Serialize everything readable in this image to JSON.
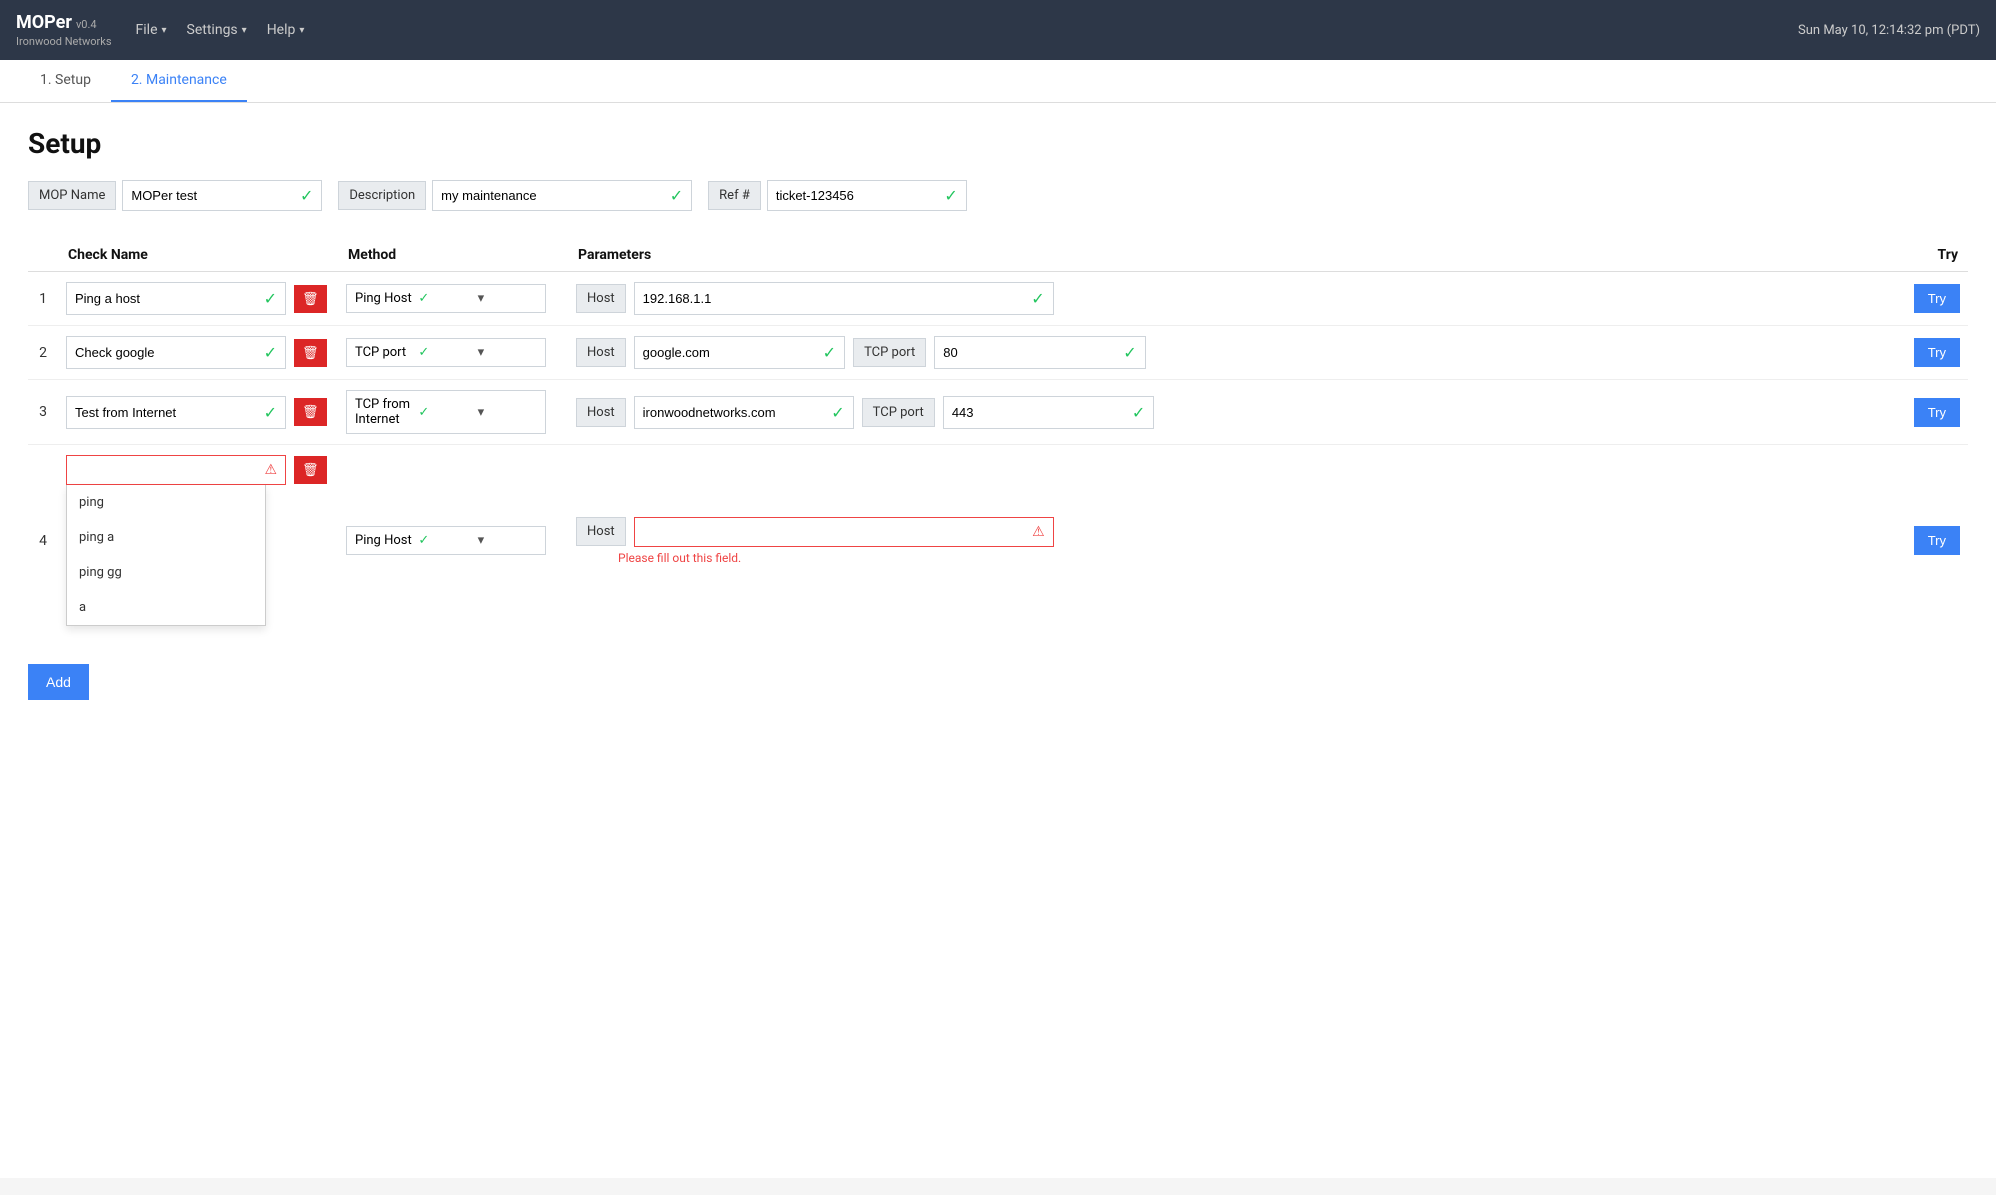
{
  "header": {
    "app_name": "MOPer",
    "app_version": "v0.4",
    "app_company": "Ironwood Networks",
    "nav": [
      {
        "label": "File",
        "id": "file"
      },
      {
        "label": "Settings",
        "id": "settings"
      },
      {
        "label": "Help",
        "id": "help"
      }
    ],
    "datetime": "Sun May 10, 12:14:32 pm (PDT)"
  },
  "tabs": [
    {
      "label": "1. Setup",
      "id": "setup",
      "active": false
    },
    {
      "label": "2. Maintenance",
      "id": "maintenance",
      "active": true
    }
  ],
  "page_title": "Setup",
  "setup_fields": {
    "mop_name_label": "MOP Name",
    "mop_name_value": "MOPer test",
    "description_label": "Description",
    "description_value": "my maintenance",
    "ref_label": "Ref #",
    "ref_value": "ticket-123456"
  },
  "table": {
    "columns": {
      "check_name": "Check Name",
      "method": "Method",
      "parameters": "Parameters",
      "try": "Try"
    },
    "rows": [
      {
        "num": "1",
        "check_name": "Ping a host",
        "valid": true,
        "method": "Ping Host",
        "params": [
          {
            "label": "Host",
            "value": "192.168.1.1",
            "valid": true
          }
        ]
      },
      {
        "num": "2",
        "check_name": "Check google",
        "valid": true,
        "method": "TCP port",
        "params": [
          {
            "label": "Host",
            "value": "google.com",
            "valid": true
          },
          {
            "label": "TCP port",
            "value": "80",
            "valid": true
          }
        ]
      },
      {
        "num": "3",
        "check_name": "Test from Internet",
        "valid": true,
        "method": "TCP from Internet",
        "params": [
          {
            "label": "Host",
            "value": "ironwoodnetworks.com",
            "valid": true
          },
          {
            "label": "TCP port",
            "value": "443",
            "valid": true
          }
        ]
      },
      {
        "num": "4",
        "check_name": "",
        "valid": false,
        "method": "Ping Host",
        "params": [
          {
            "label": "Host",
            "value": "",
            "valid": false
          }
        ],
        "error_text": "Please fill out this field."
      }
    ]
  },
  "autocomplete": {
    "items": [
      "ping",
      "ping a",
      "ping gg",
      "a"
    ]
  },
  "buttons": {
    "try_label": "Try",
    "add_label": "Add",
    "delete_icon": "🗑"
  }
}
